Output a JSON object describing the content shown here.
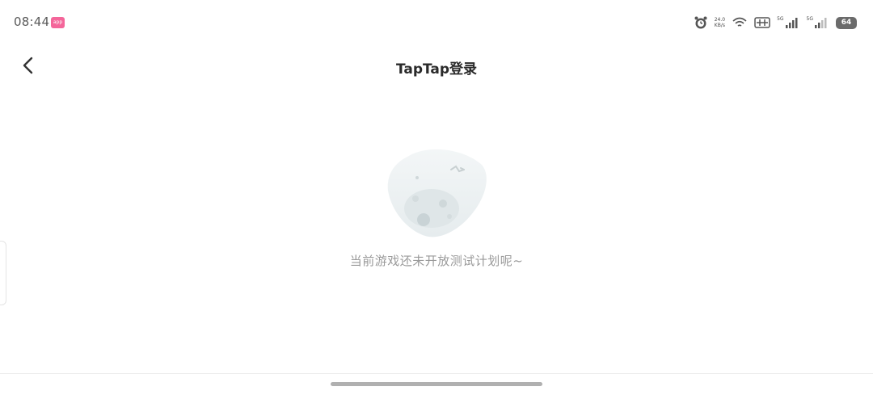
{
  "status_bar": {
    "time": "08:44",
    "notification_badge": "app",
    "net_speed_top": "24.0",
    "net_speed_bottom": "KB/s",
    "sim1_label": "5G",
    "sim2_label": "5G",
    "battery_level": "64",
    "icons": [
      "alarm-icon",
      "wifi-icon",
      "hd-icon",
      "signal-icon",
      "signal-icon",
      "battery-icon"
    ]
  },
  "nav": {
    "back_icon": "chevron-left-icon",
    "title": "TapTap登录"
  },
  "empty_state": {
    "illustration": "empty-planet-illustration",
    "message": "当前游戏还未开放测试计划呢~"
  },
  "colors": {
    "badge": "#f4669a",
    "battery": "#6b6b6b",
    "title_text": "#2a2a2a",
    "muted_text": "#9a9a9a",
    "home_indicator": "#b0b0b0"
  }
}
